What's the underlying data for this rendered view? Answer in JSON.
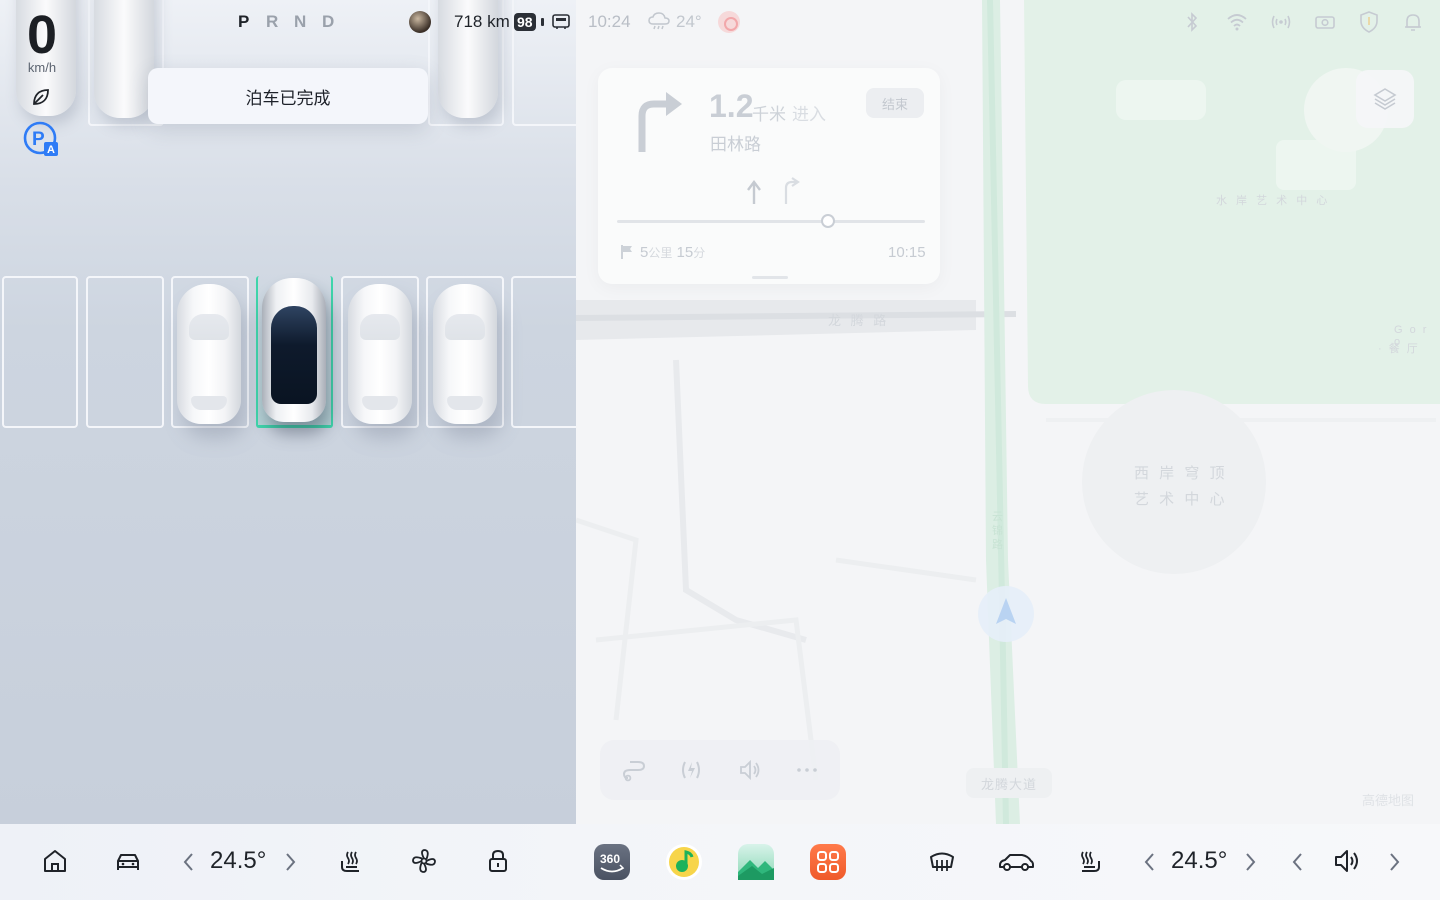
{
  "status_bar": {
    "gears": [
      "P",
      "R",
      "N",
      "D"
    ],
    "active_gear": "P",
    "range": "718 km",
    "battery": "98",
    "time": "10:24",
    "weather_temp": "24°",
    "icons": [
      "bluetooth-icon",
      "wifi-icon",
      "signal-icon",
      "dashcam-icon",
      "shield-icon",
      "bell-icon"
    ]
  },
  "speed": {
    "value": "0",
    "unit": "km/h"
  },
  "parking": {
    "toast": "泊车已完成"
  },
  "nav": {
    "distance": "1.2",
    "distance_unit": "千米",
    "action": "进入",
    "road": "田林路",
    "end_button": "结束",
    "remaining_km": "5",
    "remaining_km_unit": "公里",
    "remaining_min": "15",
    "remaining_min_unit": "分",
    "eta": "10:15"
  },
  "map": {
    "labels": {
      "road_top": "龙 腾 路",
      "art_center_small": "水 岸 艺 术 中 心",
      "west_bund_line1": "西 岸 穹 顶",
      "west_bund_line2": "艺 术 中 心",
      "road_vertical": "云锦路",
      "edge_line1": "G o r o",
      "edge_line2": "· 餐 厅",
      "road_badge": "龙腾大道",
      "provider": "高德地图"
    },
    "colors": {
      "park": "#e3f1e8",
      "road": "#e9ebee",
      "route": "#dceee4"
    }
  },
  "dock": {
    "left_temp": "24.5°",
    "right_temp": "24.5°",
    "apps": [
      {
        "name": "360-camera",
        "label": "360"
      },
      {
        "name": "music"
      },
      {
        "name": "gallery"
      },
      {
        "name": "app-center"
      }
    ]
  }
}
